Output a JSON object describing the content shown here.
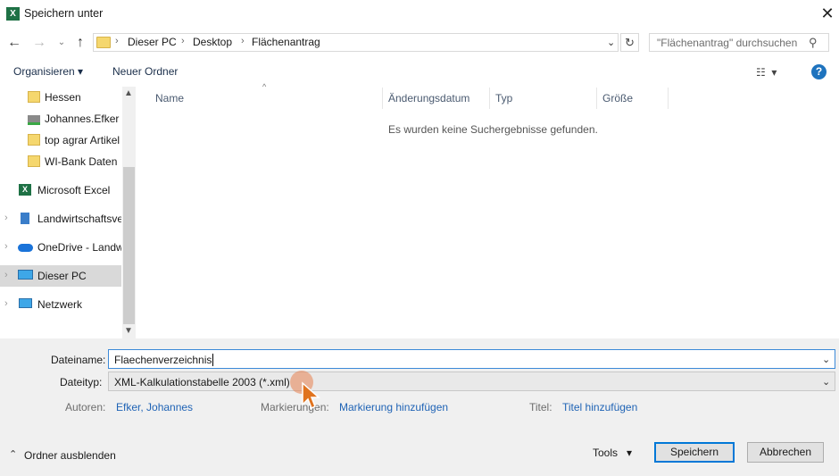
{
  "window": {
    "title": "Speichern unter",
    "app_icon": "X"
  },
  "address": {
    "crumbs": [
      "Dieser PC",
      "Desktop",
      "Flächenantrag"
    ]
  },
  "search": {
    "placeholder": "\"Flächenantrag\" durchsuchen"
  },
  "toolbar": {
    "organize": "Organisieren",
    "new_folder": "Neuer Ordner",
    "help": "?"
  },
  "sidebar": {
    "items": [
      {
        "label": "Hessen",
        "icon": "folder-icon"
      },
      {
        "label": "Johannes.Efker (",
        "icon": "network-drive-icon"
      },
      {
        "label": "top agrar Artikel",
        "icon": "folder-icon"
      },
      {
        "label": "WI-Bank Daten",
        "icon": "folder-icon"
      },
      {
        "label": "Microsoft Excel",
        "icon": "excel-icon"
      },
      {
        "label": "Landwirtschaftsve",
        "icon": "building-icon"
      },
      {
        "label": "OneDrive - Landw",
        "icon": "onedrive-icon"
      },
      {
        "label": "Dieser PC",
        "icon": "computer-icon"
      },
      {
        "label": "Netzwerk",
        "icon": "network-icon"
      }
    ]
  },
  "list": {
    "columns": [
      "Name",
      "Änderungsdatum",
      "Typ",
      "Größe"
    ],
    "empty_message": "Es wurden keine Suchergebnisse gefunden."
  },
  "form": {
    "filename_label": "Dateiname:",
    "filename_value": "Flaechenverzeichnis",
    "filetype_label": "Dateityp:",
    "filetype_value": "XML-Kalkulationstabelle 2003 (*.xml)",
    "authors_label": "Autoren:",
    "authors_value": "Efker, Johannes",
    "tags_label": "Markierungen:",
    "tags_value": "Markierung hinzufügen",
    "title_label": "Titel:",
    "title_value": "Titel hinzufügen"
  },
  "footer": {
    "hide_folders": "Ordner ausblenden",
    "tools": "Tools",
    "save": "Speichern",
    "cancel": "Abbrechen"
  },
  "colors": {
    "accent": "#0078d7",
    "link": "#1f63b5",
    "excel_green": "#1e7145"
  }
}
